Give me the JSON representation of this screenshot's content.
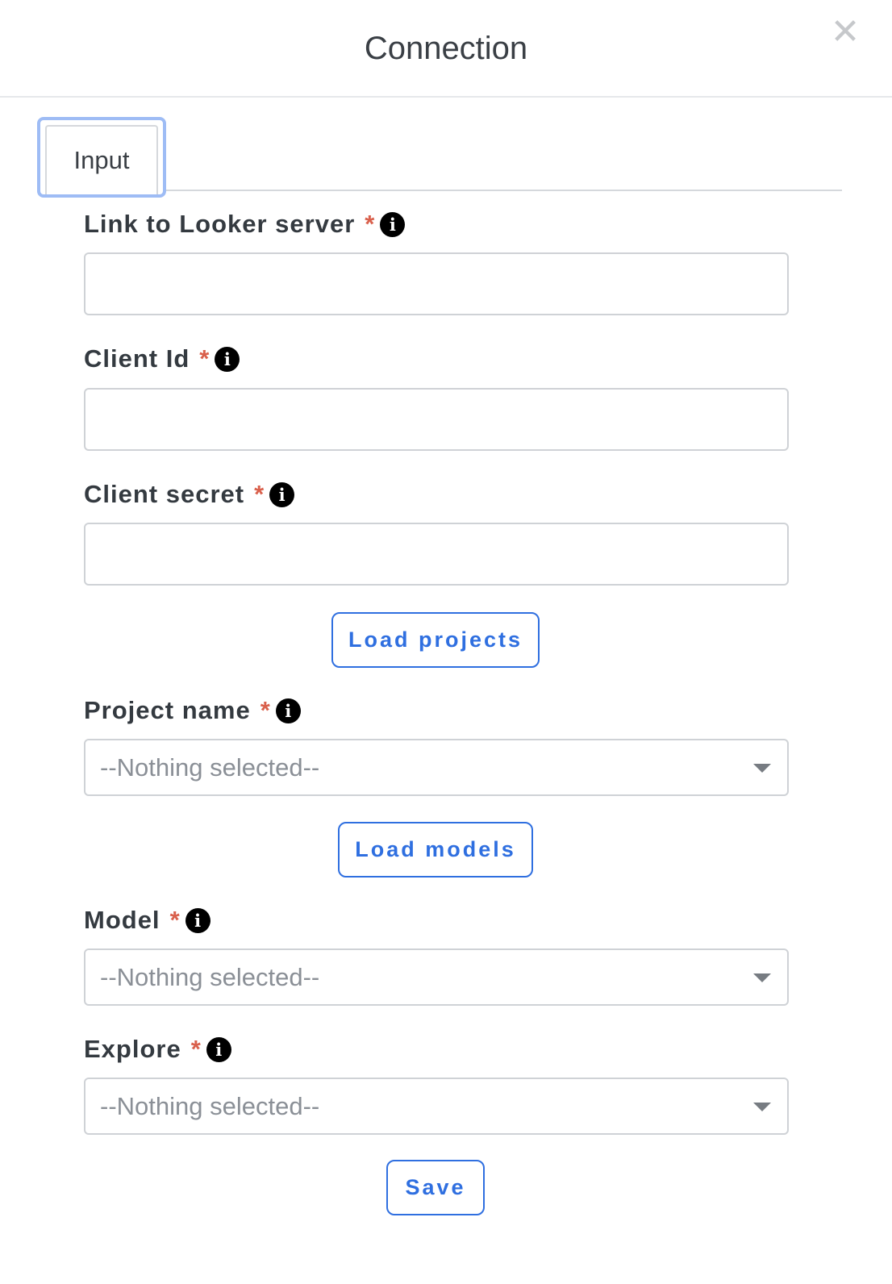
{
  "dialog": {
    "title": "Connection",
    "close_icon": "close-icon"
  },
  "tabs": [
    {
      "label": "Input",
      "active": true
    }
  ],
  "fields": {
    "looker_server": {
      "label": "Link to Looker server",
      "required_mark": "*",
      "value": ""
    },
    "client_id": {
      "label": "Client Id",
      "required_mark": "*",
      "value": ""
    },
    "client_secret": {
      "label": "Client secret",
      "required_mark": "*",
      "value": ""
    },
    "project_name": {
      "label": "Project name",
      "required_mark": "*",
      "selected": "--Nothing selected--"
    },
    "model": {
      "label": "Model",
      "required_mark": "*",
      "selected": "--Nothing selected--"
    },
    "explore": {
      "label": "Explore",
      "required_mark": "*",
      "selected": "--Nothing selected--"
    }
  },
  "buttons": {
    "load_projects": "Load projects",
    "load_models": "Load models",
    "save": "Save"
  },
  "colors": {
    "accent": "#2f6fe0",
    "required": "#d9604c",
    "tab_focus_ring": "#9ebcf5",
    "placeholder": "#8a8f96"
  }
}
